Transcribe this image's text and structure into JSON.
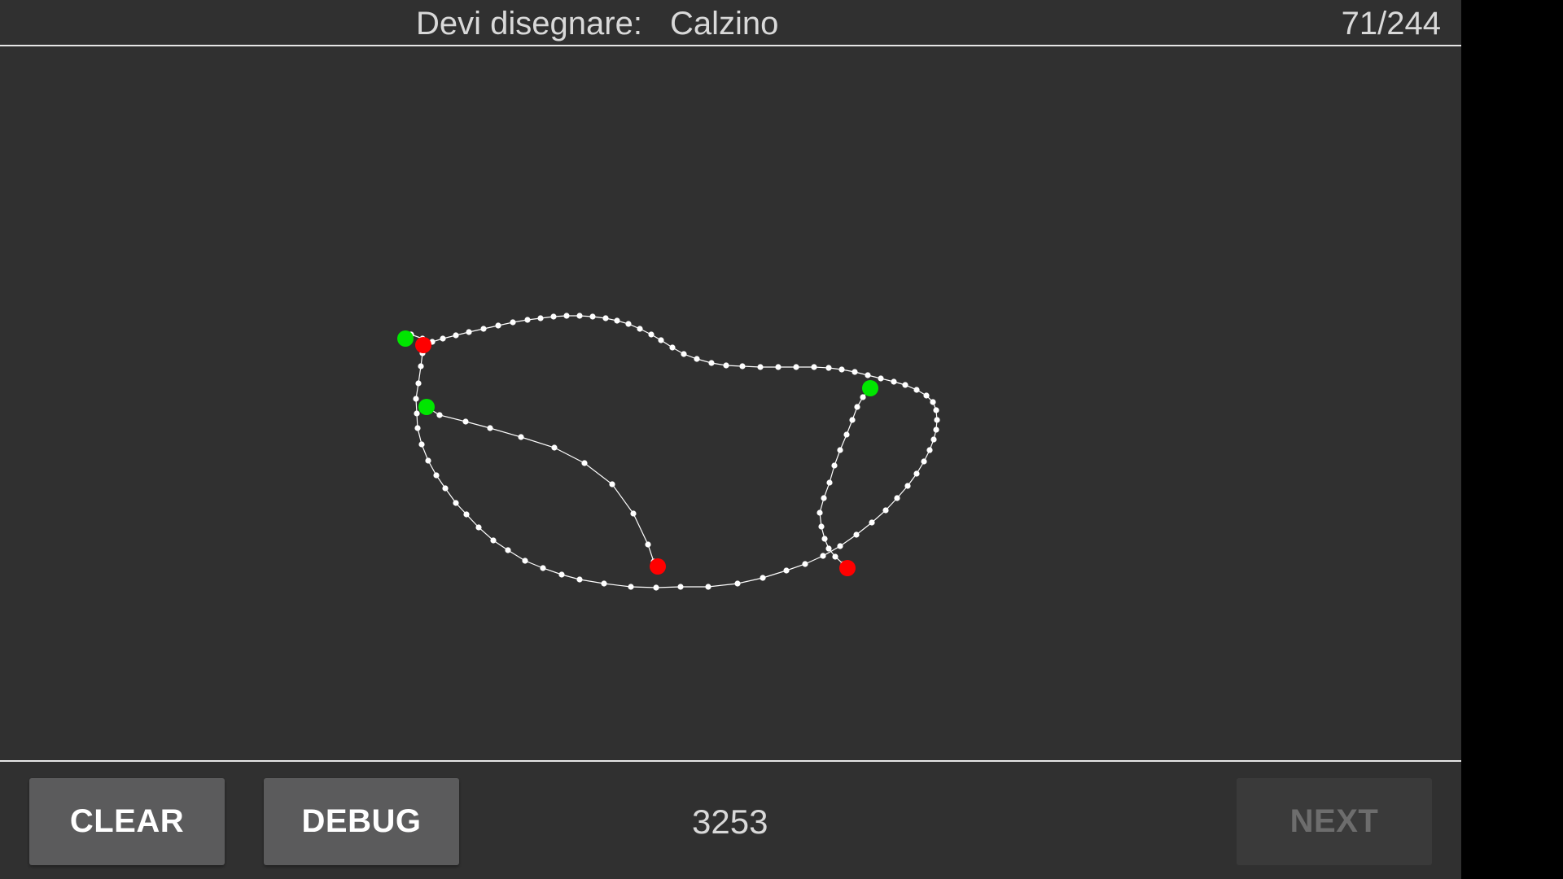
{
  "header": {
    "prompt_label": "Devi disegnare:",
    "word": "Calzino",
    "progress": "71/244"
  },
  "footer": {
    "clear_label": "CLEAR",
    "debug_label": "DEBUG",
    "score": "3253",
    "next_label": "NEXT",
    "next_enabled": false
  },
  "colors": {
    "background": "#303030",
    "stroke": "#ffffff",
    "stroke_start": "#00e600",
    "stroke_end": "#ff0000",
    "divider": "#e6e6e6"
  },
  "drawing": {
    "stroke_count": 3
  }
}
